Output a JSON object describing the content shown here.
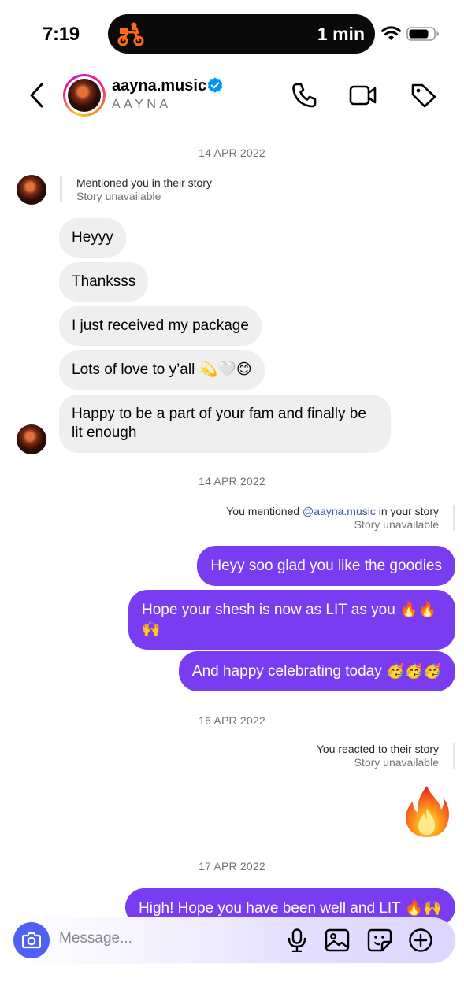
{
  "status_bar": {
    "time": "7:19",
    "activity_text": "1 min",
    "activity_icon": "delivery-scooter-icon"
  },
  "header": {
    "username": "aayna.music",
    "full_name": "AAYNA",
    "verified": true,
    "accent_ring": "#ee2a7b"
  },
  "messages": {
    "date_1": "14 APR 2022",
    "story_mention_in": {
      "line1": "Mentioned you in their story",
      "line2": "Story unavailable"
    },
    "incoming": [
      "Heyyy",
      "Thanksss",
      "I just received my package",
      "Lots of love to y’all 💫🤍😊",
      "Happy to be a part of your fam and finally be lit enough"
    ],
    "date_2": "14 APR 2022",
    "story_mention_out": {
      "prefix": "You mentioned ",
      "handle": "@aayna.music",
      "suffix": " in your story",
      "line2": "Story unavailable"
    },
    "outgoing_1": [
      "Heyy soo glad you like the goodies",
      "Hope your shesh is now as LIT as you 🔥🔥 🙌",
      "And happy celebrating today 🥳🥳🥳"
    ],
    "date_3": "16 APR 2022",
    "story_reaction": {
      "line1": "You reacted to their story",
      "line2": "Story unavailable",
      "reaction": "fire-emoji"
    },
    "date_4": "17 APR 2022",
    "outgoing_2": "High! Hope you have been well and LIT 🔥🙌"
  },
  "composer": {
    "placeholder": "Message...",
    "camera_color": "#4e61f5"
  },
  "colors": {
    "outgoing_bubble": "#7a3cf0",
    "incoming_bubble": "#efefef",
    "verified_badge": "#0095f6"
  }
}
